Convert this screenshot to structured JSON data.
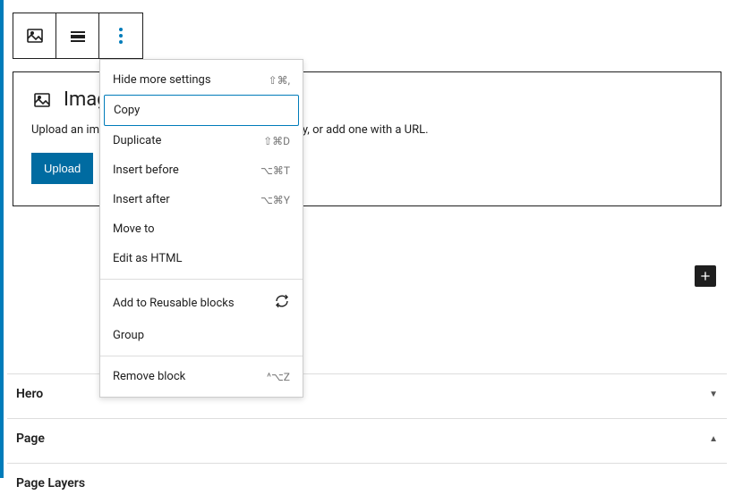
{
  "block": {
    "title": "Image",
    "description": "Upload an image file, pick one from your media library, or add one with a URL.",
    "upload_label": "Upload"
  },
  "menu": {
    "group1": [
      {
        "label": "Hide more settings",
        "shortcut": "⇧⌘,"
      },
      {
        "label": "Copy",
        "shortcut": "",
        "selected": true
      },
      {
        "label": "Duplicate",
        "shortcut": "⇧⌘D"
      },
      {
        "label": "Insert before",
        "shortcut": "⌥⌘T"
      },
      {
        "label": "Insert after",
        "shortcut": "⌥⌘Y"
      },
      {
        "label": "Move to",
        "shortcut": ""
      },
      {
        "label": "Edit as HTML",
        "shortcut": ""
      }
    ],
    "group2": [
      {
        "label": "Add to Reusable blocks",
        "icon": "reusable"
      },
      {
        "label": "Group"
      }
    ],
    "group3": [
      {
        "label": "Remove block",
        "shortcut": "^⌥Z"
      }
    ]
  },
  "accordions": {
    "hero": "Hero",
    "page": "Page",
    "layers": "Page Layers"
  }
}
